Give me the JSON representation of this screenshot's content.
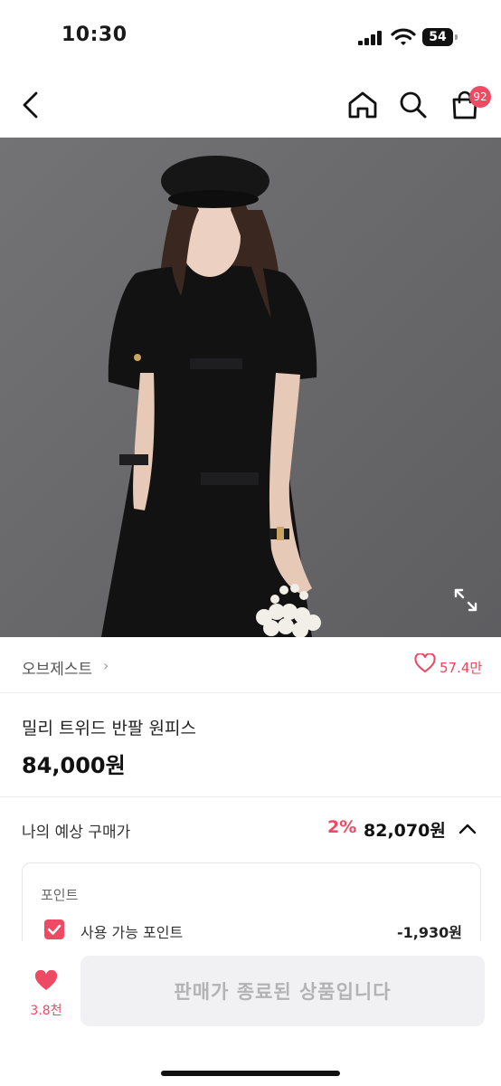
{
  "status_bar": {
    "time": "10:30",
    "battery": "54",
    "battery_level": 0.54,
    "signal_icon": "cellular-signal-icon",
    "wifi_icon": "wifi-icon"
  },
  "nav": {
    "back_icon": "chevron-left-icon",
    "home_icon": "home-icon",
    "search_icon": "search-icon",
    "cart_icon": "shopping-bag-icon",
    "cart_count": "92"
  },
  "product": {
    "image_expand_icon": "expand-icon",
    "brand": "오브제스트",
    "brand_chevron": "›",
    "likes": "57.4만",
    "name": "밀리 트위드 반팔 원피스",
    "price": "84,000원"
  },
  "estimate": {
    "label": "나의 예상 구매가",
    "discount_rate": "2%",
    "price": "82,070원",
    "toggle_icon": "chevron-up-icon"
  },
  "points": {
    "title": "포인트",
    "option_label": "사용 가능 포인트",
    "option_checked": true,
    "value": "-1,930원"
  },
  "bottom_bar": {
    "wish_icon": "heart-filled-icon",
    "wish_count": "3.8천",
    "sold_out_label": "판매가 종료된 상품입니다"
  },
  "colors": {
    "accent": "#ef4a64",
    "disabled_bg": "#f1f1f3",
    "disabled_text": "#b3b3b7"
  }
}
